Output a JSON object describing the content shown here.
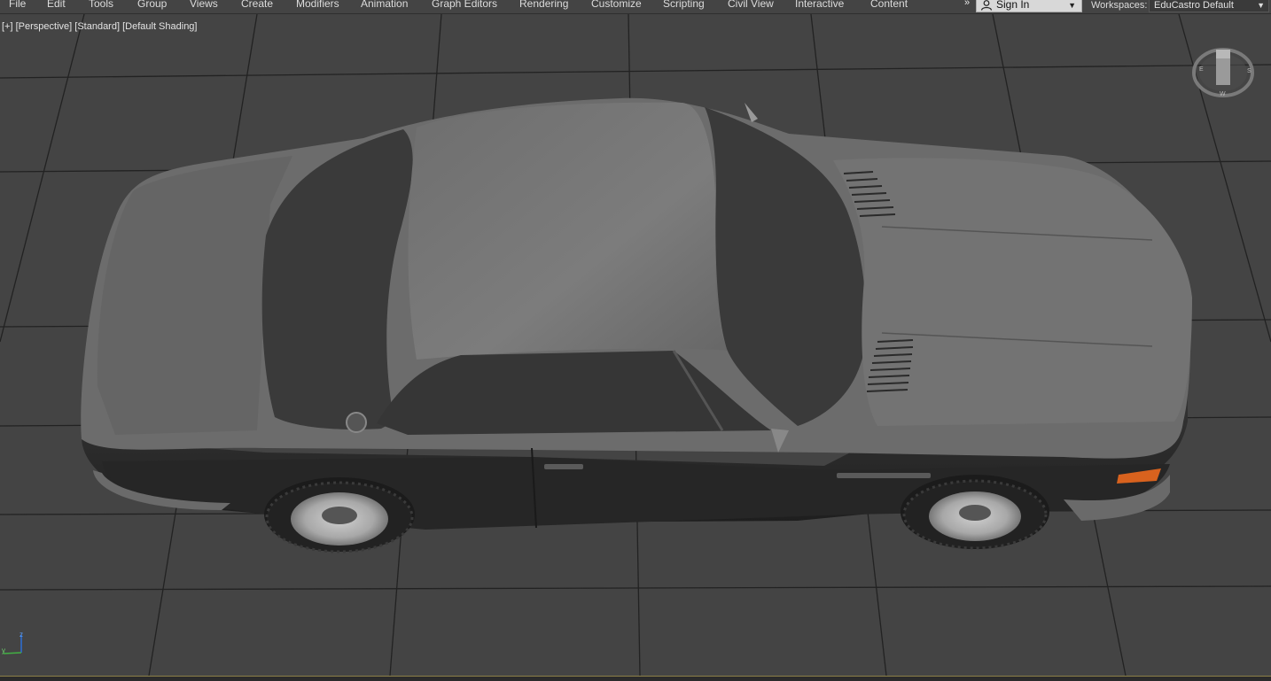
{
  "menu": {
    "items": [
      {
        "label": "File",
        "id": "file"
      },
      {
        "label": "Edit",
        "id": "edit"
      },
      {
        "label": "Tools",
        "id": "tools"
      },
      {
        "label": "Group",
        "id": "group"
      },
      {
        "label": "Views",
        "id": "views"
      },
      {
        "label": "Create",
        "id": "create"
      },
      {
        "label": "Modifiers",
        "id": "modifiers"
      },
      {
        "label": "Animation",
        "id": "animation"
      },
      {
        "label": "Graph Editors",
        "id": "graph-editors"
      },
      {
        "label": "Rendering",
        "id": "rendering"
      },
      {
        "label": "Customize",
        "id": "customize"
      },
      {
        "label": "Scripting",
        "id": "scripting"
      },
      {
        "label": "Civil View",
        "id": "civil-view"
      },
      {
        "label": "Interactive",
        "id": "interactive"
      },
      {
        "label": "Content",
        "id": "content"
      }
    ],
    "overflow_icon": "double-chevron-right-icon"
  },
  "account": {
    "sign_in_label": "Sign In",
    "icon": "person-icon"
  },
  "workspaces": {
    "label": "Workspaces:",
    "value": "EduCastro Default"
  },
  "viewport": {
    "labels": {
      "plus": "[+]",
      "view": "[Perspective]",
      "mode": "[Standard]",
      "shading": "[Default Shading]"
    },
    "viewcube_icon": "viewcube-compass-icon",
    "axis_icon": "axis-tripod-icon",
    "axis_labels": {
      "y": "y",
      "z": "z"
    },
    "colors": {
      "background": "#444444",
      "grid": "#222222",
      "car_body": "#6a6a6a",
      "glass": "#3a3a3a",
      "turn_signal": "#d8621e"
    }
  }
}
